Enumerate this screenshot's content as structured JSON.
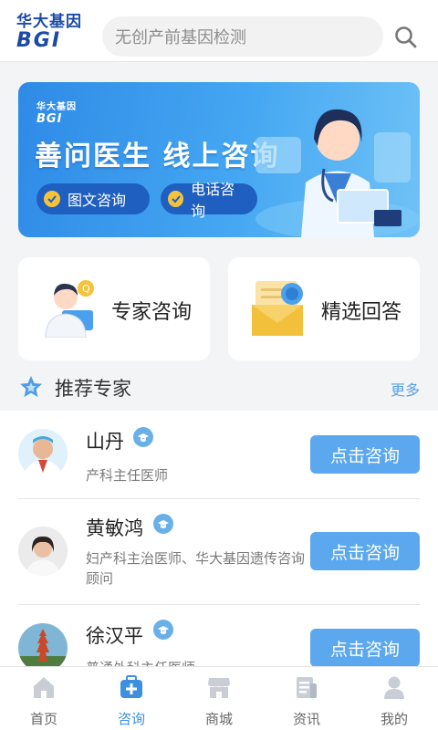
{
  "header": {
    "logo_cn": "华大基因",
    "logo_en": "BGI",
    "search_placeholder": "无创产前基因检测"
  },
  "banner": {
    "logo_cn": "华大基因",
    "logo_en": "BGI",
    "title": "善问医生 线上咨询",
    "pills": [
      "图文咨询",
      "电话咨询"
    ]
  },
  "cards": [
    {
      "label": "专家咨询",
      "icon": "doctor-icon"
    },
    {
      "label": "精选回答",
      "icon": "certificate-icon"
    }
  ],
  "section": {
    "title": "推荐专家",
    "more": "更多"
  },
  "experts": [
    {
      "name": "山丹",
      "desc": "产科主任医师",
      "button": "点击咨询"
    },
    {
      "name": "黄敏鸿",
      "desc": "妇产科主治医师、华大基因遗传咨询顾问",
      "button": "点击咨询"
    },
    {
      "name": "徐汉平",
      "desc": "普通外科主任医师",
      "button": "点击咨询"
    }
  ],
  "nav": {
    "items": [
      {
        "label": "首页",
        "icon": "home-icon"
      },
      {
        "label": "咨询",
        "icon": "medical-kit-icon",
        "active": true
      },
      {
        "label": "商城",
        "icon": "store-icon"
      },
      {
        "label": "资讯",
        "icon": "news-icon"
      },
      {
        "label": "我的",
        "icon": "user-icon"
      }
    ]
  },
  "colors": {
    "accent": "#3d8fe0",
    "button": "#5ba8ef",
    "brand": "#1b4aa8"
  }
}
